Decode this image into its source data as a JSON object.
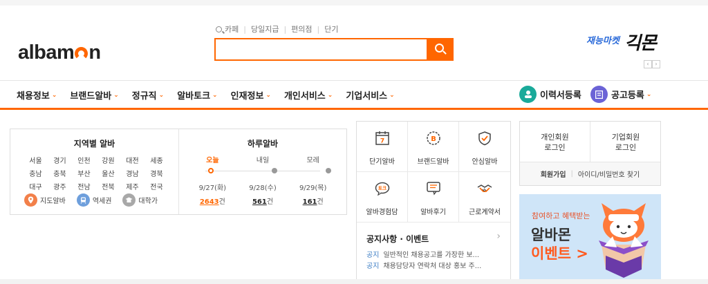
{
  "header": {
    "logo": {
      "part1": "albam",
      "part2": "n"
    },
    "quick_links": [
      "카페",
      "당일지급",
      "편의점",
      "단기"
    ],
    "search": {
      "value": "",
      "placeholder": ""
    },
    "ad": {
      "small": "재능마켓",
      "big": "긱몬"
    }
  },
  "gnb": {
    "items": [
      "채용정보",
      "브랜드알바",
      "정규직",
      "알바토크",
      "인재정보",
      "개인서비스",
      "기업서비스"
    ],
    "resume_label": "이력서등록",
    "post_label": "공고등록"
  },
  "region": {
    "title": "지역별 알바",
    "cities": [
      "서울",
      "경기",
      "인천",
      "강원",
      "대전",
      "세종",
      "충남",
      "충북",
      "부산",
      "울산",
      "경남",
      "경북",
      "대구",
      "광주",
      "전남",
      "전북",
      "제주",
      "전국"
    ],
    "map_label": "지도알바",
    "station_label": "역세권",
    "university_label": "대학가"
  },
  "daily": {
    "title": "하루알바",
    "days": [
      {
        "label": "오늘",
        "date": "9/27(화)",
        "count": "2643",
        "unit": "건"
      },
      {
        "label": "내일",
        "date": "9/28(수)",
        "count": "561",
        "unit": "건"
      },
      {
        "label": "모레",
        "date": "9/29(목)",
        "count": "161",
        "unit": "건"
      }
    ]
  },
  "services": {
    "items": [
      "단기알바",
      "브랜드알바",
      "안심알바",
      "알바경험담",
      "알바후기",
      "근로계약서"
    ],
    "short_term_icon_text": "7",
    "brand_icon_text": "B",
    "experience_icon_text": "토크"
  },
  "notice": {
    "title": "공지사항 · 이벤트",
    "rows": [
      {
        "tag": "공지",
        "text": "일반적인 채용공고를 가장한 보..."
      },
      {
        "tag": "공지",
        "text": "채용담당자 연락처 대상 홍보 주..."
      }
    ]
  },
  "login": {
    "personal_line1": "개인회원",
    "personal_line2": "로그인",
    "corp_line1": "기업회원",
    "corp_line2": "로그인",
    "join": "회원가입",
    "find": "아이디/비밀번호 찾기"
  },
  "banner": {
    "sub": "참여하고 혜택받는",
    "line1": "알바몬",
    "line2": "이벤트 >"
  },
  "colors": {
    "accent": "#ff6600",
    "teal": "#1aaa9a",
    "purple": "#6b63d6"
  }
}
